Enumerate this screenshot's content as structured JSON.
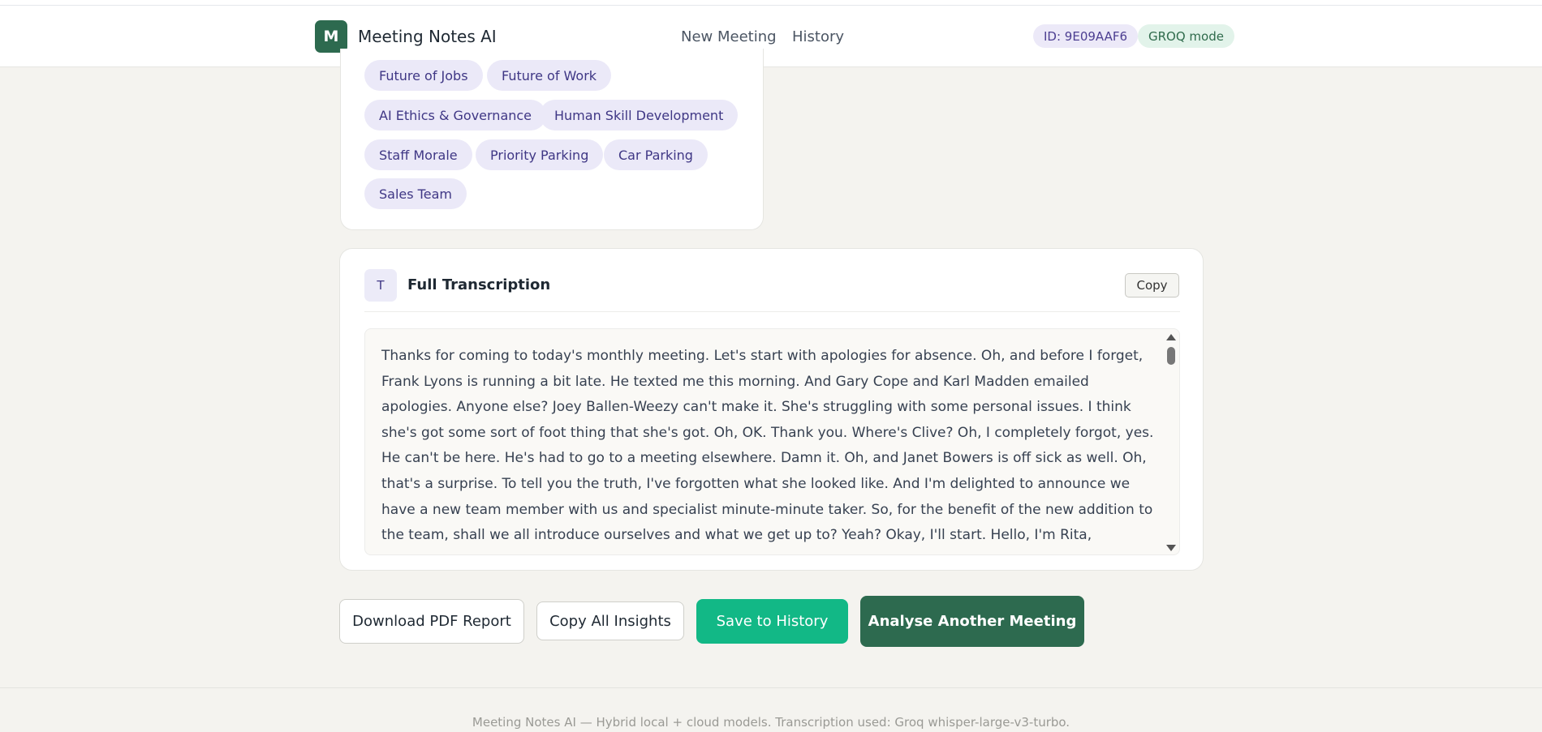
{
  "header": {
    "logo_letter": "M",
    "app_title": "Meeting Notes AI",
    "nav": [
      "New Meeting",
      "History"
    ],
    "meeting_id": "ID: 9E09AAF6",
    "mode": "GROQ mode"
  },
  "topics": [
    "Future of Jobs",
    "Future of Work",
    "AI Ethics & Governance",
    "Human Skill Development",
    "Staff Morale",
    "Priority Parking",
    "Car Parking",
    "Sales Team"
  ],
  "transcription": {
    "badge": "T",
    "title": "Full Transcription",
    "copy_label": "Copy",
    "text": "Thanks for coming to today's monthly meeting. Let's start with apologies for absence. Oh, and before I forget, Frank Lyons is running a bit late. He texted me this morning. And Gary Cope and Karl Madden emailed apologies. Anyone else? Joey Ballen-Weezy can't make it. She's struggling with some personal issues. I think she's got some sort of foot thing that she's got. Oh, OK. Thank you. Where's Clive? Oh, I completely forgot, yes. He can't be here. He's had to go to a meeting elsewhere. Damn it. Oh, and Janet Bowers is off sick as well. Oh, that's a surprise. To tell you the truth, I've forgotten what she looked like. And I'm delighted to announce we have a new team member with us and specialist minute-minute taker. So, for the benefit of the new addition to the team, shall we all introduce ourselves and what we get up to? Yeah? Okay, I'll start. Hello, I'm Rita, Managing Director, as you know. Hi, I'm Jason Somerville. I'm the new Project and Program Manager"
  },
  "actions": {
    "download_pdf": "Download PDF Report",
    "copy_all": "Copy All Insights",
    "save_history": "Save to History",
    "analyse_another": "Analyse Another Meeting"
  },
  "footer": {
    "text": "Meeting Notes AI — Hybrid local + cloud models. Transcription used: Groq whisper-large-v3-turbo."
  },
  "colors": {
    "brand": "#2d6a4f",
    "save": "#12b886",
    "tag_bg": "#ebe9f8",
    "tag_text": "#3f3785"
  }
}
